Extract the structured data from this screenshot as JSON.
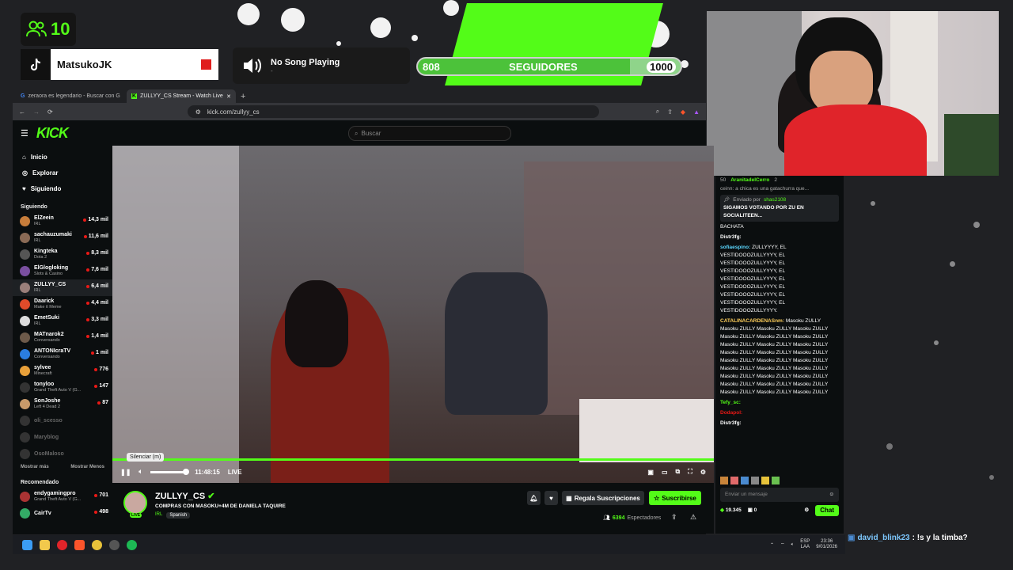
{
  "overlay": {
    "viewer_count": "10",
    "tiktok_user": "MatsukoJK",
    "song_title": "No Song Playing",
    "song_sub": "-",
    "followers_current": "808",
    "followers_label": "SEGUIDORES",
    "followers_goal": "1000",
    "followers_progress": 0.808,
    "accent": "#53fc18"
  },
  "browser": {
    "tabs": [
      {
        "label": "zeraora es legendario - Buscar con G"
      },
      {
        "label": "ZULLYY_CS Stream - Watch Live"
      }
    ],
    "url": "kick.com/zullyy_cs"
  },
  "kick": {
    "logo": "KICK",
    "search_placeholder": "Buscar",
    "nav": [
      "Inicio",
      "Explorar",
      "Siguiendo"
    ],
    "following_title": "Siguiendo",
    "channels": [
      {
        "name": "ElZeein",
        "cat": "IRL",
        "viewers": "14,3 mil",
        "color": "#c77d3b"
      },
      {
        "name": "sachauzumaki",
        "cat": "IRL",
        "viewers": "11,6 mil",
        "color": "#8a6a55"
      },
      {
        "name": "Kingteka",
        "cat": "Dota 2",
        "viewers": "8,3 mil",
        "color": "#555"
      },
      {
        "name": "ElGlogloking",
        "cat": "Slots & Casino",
        "viewers": "7,6 mil",
        "color": "#7a4fa0"
      },
      {
        "name": "ZULLYY_CS",
        "cat": "IRL",
        "viewers": "6,4 mil",
        "color": "#9a7f7a"
      },
      {
        "name": "Daarick",
        "cat": "Make it Meme",
        "viewers": "4,4 mil",
        "color": "#e04b2a"
      },
      {
        "name": "EmetSuki",
        "cat": "IRL",
        "viewers": "3,3 mil",
        "color": "#ddd"
      },
      {
        "name": "MATnarok2",
        "cat": "Conversando",
        "viewers": "1,4 mil",
        "color": "#6d5a4a"
      },
      {
        "name": "ANTONIcraTV",
        "cat": "Conversando",
        "viewers": "1 mil",
        "color": "#2a7de0"
      },
      {
        "name": "sylvee",
        "cat": "Minecraft",
        "viewers": "776",
        "color": "#e8a03a"
      },
      {
        "name": "tonyloo",
        "cat": "Grand Theft Auto V (G...",
        "viewers": "147",
        "color": "#333"
      },
      {
        "name": "SonJoshe",
        "cat": "Left 4 Dead 2",
        "viewers": "87",
        "color": "#c89a6a"
      }
    ],
    "offline": [
      "oli_scesso",
      "Maryblog",
      "OsoMaloso"
    ],
    "show_more": "Mostrar más",
    "show_less": "Mostrar Menos",
    "recommended_title": "Recomendado",
    "recommended": [
      {
        "name": "endygamingpro",
        "cat": "Grand Theft Auto V (G...",
        "viewers": "701",
        "color": "#a33"
      },
      {
        "name": "CairTv",
        "cat": "",
        "viewers": "498",
        "color": "#3a6"
      }
    ],
    "player": {
      "tooltip": "Silenciar (m)",
      "time": "11:48:15",
      "live": "LIVE",
      "progress": 1.0
    },
    "stream": {
      "channel": "ZULLYY_CS",
      "title": "COMPRAS CON MASOKU+4M DE DANIELA TAQUIRE",
      "category": "IRL",
      "language": "Spanish",
      "live_badge": "LIVE",
      "gift_label": "Regala Suscripciones",
      "subscribe_label": "Suscribirse",
      "viewers": "6394",
      "viewers_label": "Espectadores"
    }
  },
  "chat": {
    "top_user": "AranitadelCerro",
    "top_count": "50",
    "top_count2": "2",
    "pinned_line": "ceinn: a chica es una gatachurra que...",
    "sent_by_label": "Enviado por",
    "sent_by_user": "shas2108",
    "pinned_text": "SIGAMOS VOTANDO POR ZU EN SOCIALITEEN...",
    "messages": [
      {
        "user": "",
        "text": "BACHATA",
        "color": "#fff"
      },
      {
        "user": "Distr3fg:",
        "text": "",
        "color": "#fff"
      },
      {
        "user": "sofiaespino:",
        "text": "ZULLYYYY, EL VESTIDOOOZULLYYYY, EL VESTIDOOOZULLYYYY, EL VESTIDOOOZULLYYYY, EL VESTIDOOOZULLYYYY, EL VESTIDOOOZULLYYYY, EL VESTIDOOOZULLYYYY, EL VESTIDOOOZULLYYYY, EL VESTIDOOOZULLYYYY.",
        "color": "#5bd7ff"
      },
      {
        "user": "CATALINACARDENASnm:",
        "text": "Masoku ZULLY Masoku ZULLY Masoku ZULLY Masoku ZULLY Masoku ZULLY Masoku ZULLY Masoku ZULLY Masoku ZULLY Masoku ZULLY Masoku ZULLY Masoku ZULLY Masoku ZULLY Masoku ZULLY Masoku ZULLY Masoku ZULLY Masoku ZULLY Masoku ZULLY Masoku ZULLY Masoku ZULLY Masoku ZULLY Masoku ZULLY Masoku ZULLY Masoku ZULLY Masoku ZULLY Masoku ZULLY Masoku ZULLY Masoku ZULLY Masoku ZULLY",
        "color": "#ffcf5b"
      },
      {
        "user": "Tefy_sc:",
        "text": "",
        "color": "#53fc18"
      },
      {
        "user": "Dodapol:",
        "text": "",
        "color": "#e91916"
      },
      {
        "user": "Distr3fg:",
        "text": "",
        "color": "#fff"
      }
    ],
    "input_placeholder": "Enviar un mensaje",
    "points": "19.345",
    "zero": "0",
    "send_label": "Chat"
  },
  "side_chat": {
    "user": "david_blink23",
    "text": ": !s y la timba?"
  },
  "taskbar": {
    "lang": "ESP",
    "lang2": "LAA",
    "time": "23:36",
    "date": "9/01/2026"
  }
}
